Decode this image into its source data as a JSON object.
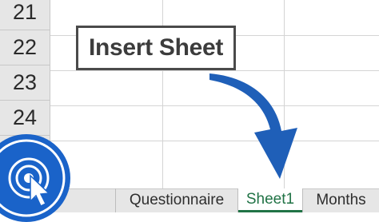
{
  "row_headers": [
    "21",
    "22",
    "23",
    "24"
  ],
  "callout": {
    "label": "Insert Sheet"
  },
  "sheet_tabs": [
    {
      "label": "Questionnaire",
      "active": false
    },
    {
      "label": "Sheet1",
      "active": true
    },
    {
      "label": "Months",
      "active": false
    }
  ],
  "icons": {
    "arrow": "curved-arrow-icon",
    "badge": "click-cursor-icon"
  },
  "colors": {
    "arrow": "#1f5fb8",
    "badge": "#1a63c9",
    "active_tab": "#217346"
  }
}
